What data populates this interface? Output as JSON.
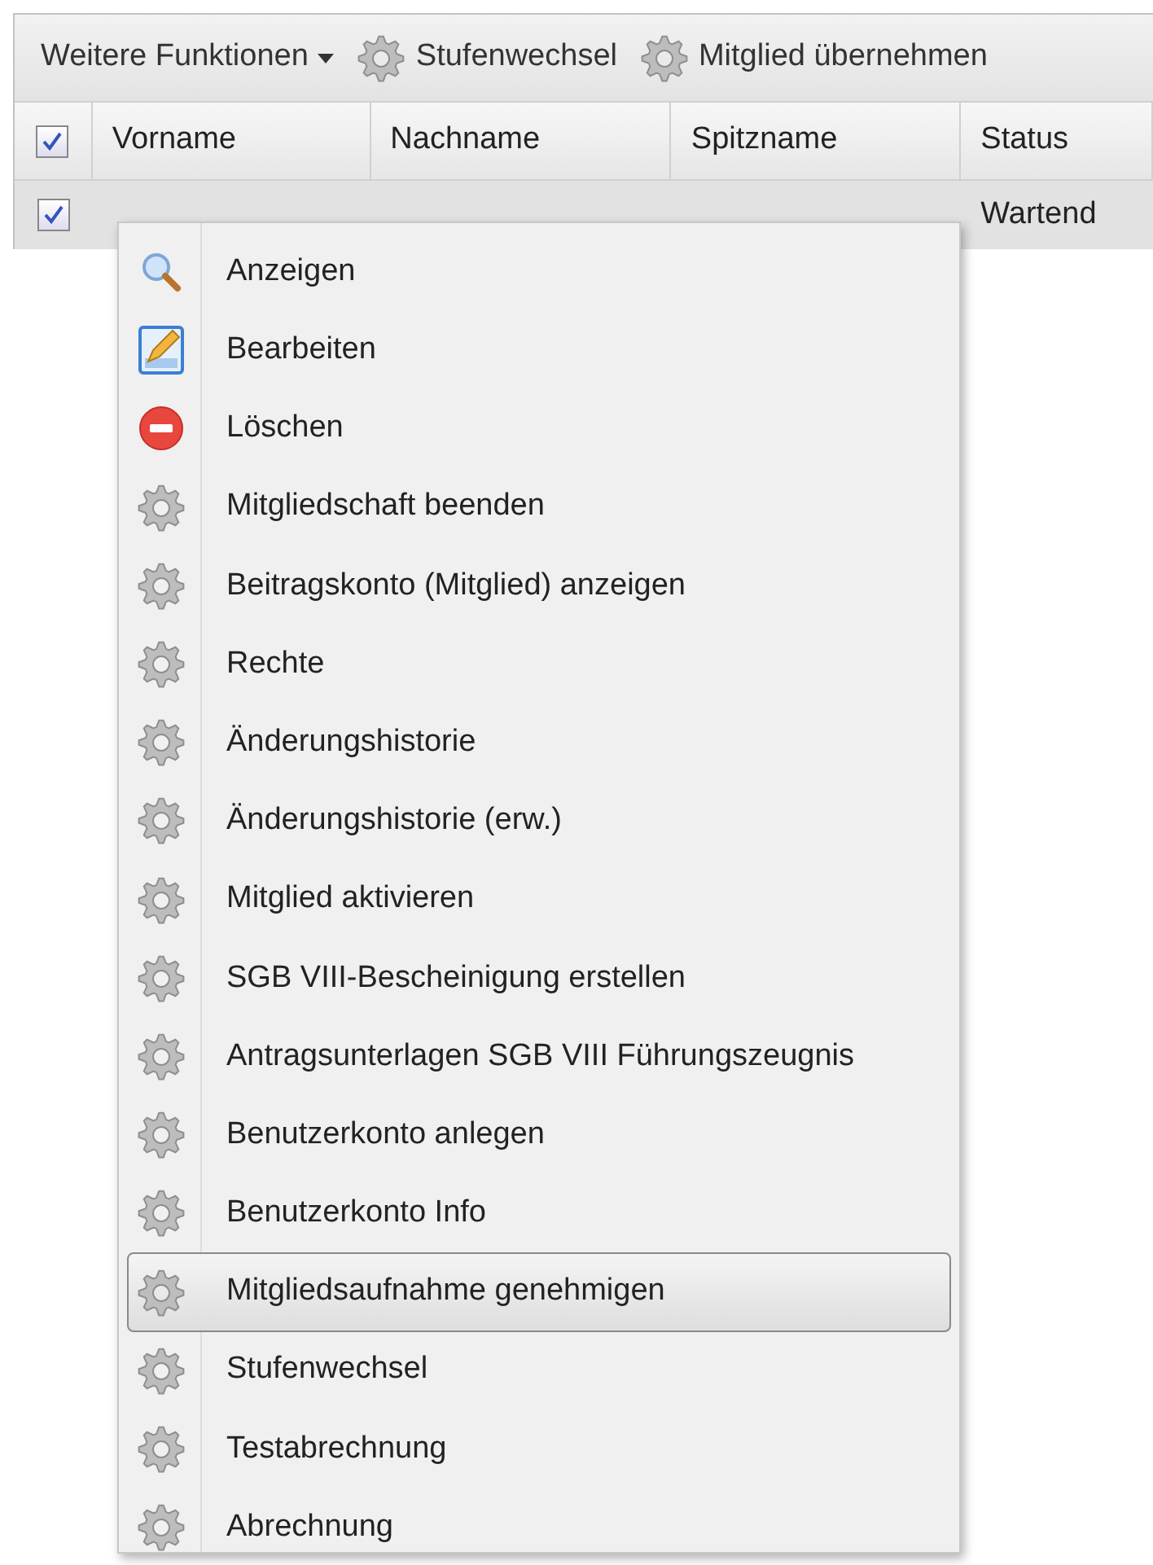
{
  "toolbar": [
    {
      "kind": "dropdown",
      "label": "Weitere Funktionen"
    },
    {
      "kind": "gear",
      "label": "Stufenwechsel"
    },
    {
      "kind": "gear",
      "label": "Mitglied übernehmen"
    }
  ],
  "table": {
    "select_all_checked": true,
    "columns": [
      "Vorname",
      "Nachname",
      "Spitzname",
      "Status"
    ],
    "rows": [
      {
        "checked": true,
        "selected": true,
        "cells": [
          "",
          "",
          "",
          "Wartend"
        ]
      }
    ]
  },
  "context_menu": {
    "items": [
      {
        "kind": "view",
        "label": "Anzeigen",
        "selected": false
      },
      {
        "kind": "edit",
        "label": "Bearbeiten",
        "selected": false
      },
      {
        "kind": "delete",
        "label": "Löschen",
        "selected": false
      },
      {
        "kind": "gear",
        "label": "Mitgliedschaft beenden",
        "selected": false
      },
      {
        "kind": "gear",
        "label": "Beitragskonto (Mitglied) anzeigen",
        "selected": false
      },
      {
        "kind": "gear",
        "label": "Rechte",
        "selected": false
      },
      {
        "kind": "gear",
        "label": "Änderungshistorie",
        "selected": false
      },
      {
        "kind": "gear",
        "label": "Änderungshistorie (erw.)",
        "selected": false
      },
      {
        "kind": "gear",
        "label": "Mitglied aktivieren",
        "selected": false
      },
      {
        "kind": "gear",
        "label": "SGB VIII-Bescheinigung erstellen",
        "selected": false
      },
      {
        "kind": "gear",
        "label": "Antragsunterlagen SGB VIII Führungszeugnis",
        "selected": false
      },
      {
        "kind": "gear",
        "label": "Benutzerkonto anlegen",
        "selected": false
      },
      {
        "kind": "gear",
        "label": "Benutzerkonto Info",
        "selected": false
      },
      {
        "kind": "gear",
        "label": "Mitgliedsaufnahme genehmigen",
        "selected": true
      },
      {
        "kind": "gear",
        "label": "Stufenwechsel",
        "selected": false
      },
      {
        "kind": "gear",
        "label": "Testabrechnung",
        "selected": false
      },
      {
        "kind": "gear",
        "label": "Abrechnung",
        "selected": false
      }
    ]
  }
}
